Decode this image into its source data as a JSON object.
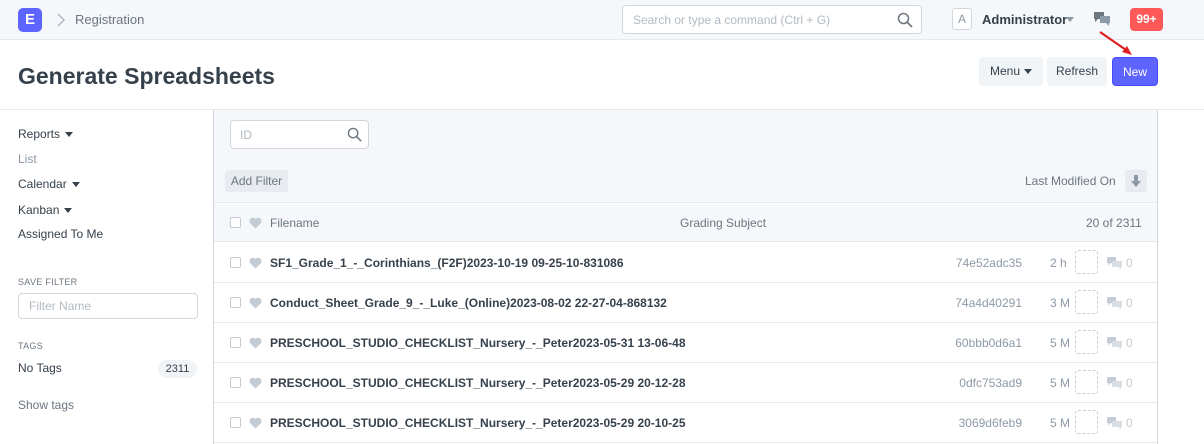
{
  "navbar": {
    "logo_letter": "E",
    "breadcrumb": "Registration",
    "search_placeholder": "Search or type a command (Ctrl + G)",
    "avatar_letter": "A",
    "user_name": "Administrator",
    "notifications_badge": "99+"
  },
  "page": {
    "title": "Generate Spreadsheets",
    "menu_label": "Menu",
    "refresh_label": "Refresh",
    "new_label": "New"
  },
  "sidebar": {
    "reports": "Reports",
    "list": "List",
    "calendar": "Calendar",
    "kanban": "Kanban",
    "assigned": "Assigned To Me",
    "save_filter_label": "SAVE FILTER",
    "filter_name_placeholder": "Filter Name",
    "tags_label": "TAGS",
    "no_tags": "No Tags",
    "no_tags_count": "2311",
    "show_tags": "Show tags"
  },
  "list": {
    "id_placeholder": "ID",
    "add_filter": "Add Filter",
    "sort_label": "Last Modified On",
    "columns": {
      "filename": "Filename",
      "grading_subject": "Grading Subject"
    },
    "count": "20 of 2311",
    "rows": [
      {
        "filename": "SF1_Grade_1_-_Corinthians_(F2F)2023-10-19 09-25-10-831086",
        "id": "74e52adc35",
        "age": "2 h",
        "comments": "0"
      },
      {
        "filename": "Conduct_Sheet_Grade_9_-_Luke_(Online)2023-08-02 22-27-04-868132",
        "id": "74a4d40291",
        "age": "3 M",
        "comments": "0"
      },
      {
        "filename": "PRESCHOOL_STUDIO_CHECKLIST_Nursery_-_Peter2023-05-31 13-06-48",
        "id": "60bbb0d6a1",
        "age": "5 M",
        "comments": "0"
      },
      {
        "filename": "PRESCHOOL_STUDIO_CHECKLIST_Nursery_-_Peter2023-05-29 20-12-28",
        "id": "0dfc753ad9",
        "age": "5 M",
        "comments": "0"
      },
      {
        "filename": "PRESCHOOL_STUDIO_CHECKLIST_Nursery_-_Peter2023-05-29 20-10-25",
        "id": "3069d6feb9",
        "age": "5 M",
        "comments": "0"
      }
    ]
  },
  "colors": {
    "primary": "#5e64ff",
    "badge": "#ff5858",
    "annotation_arrow": "#e02020"
  }
}
